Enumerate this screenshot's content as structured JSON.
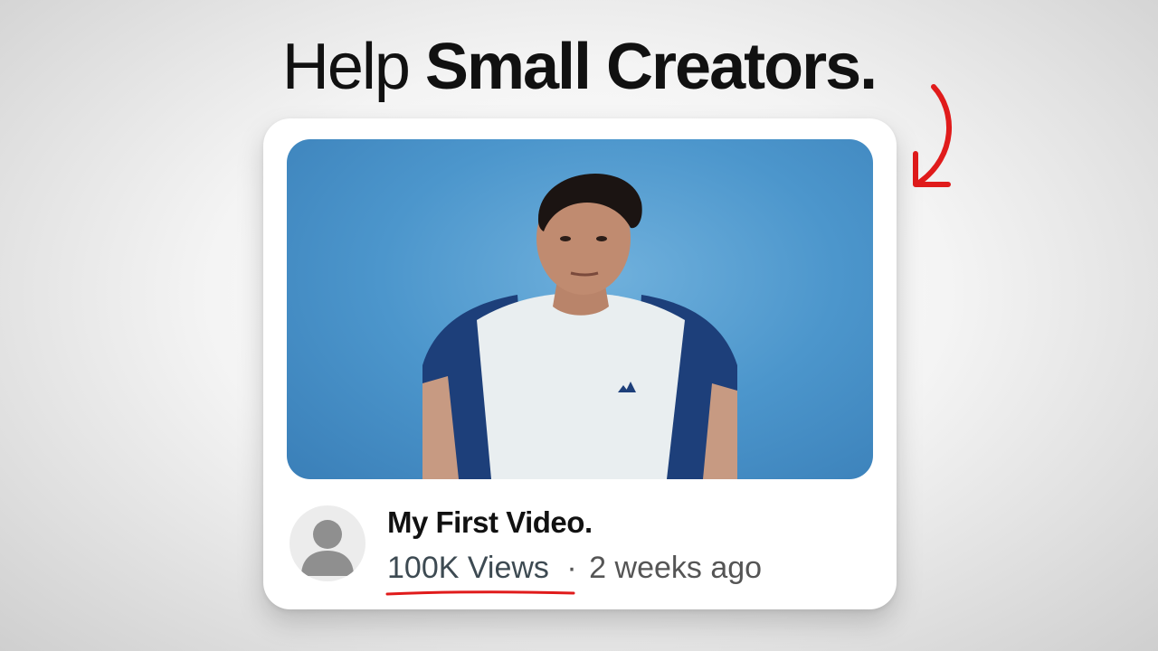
{
  "headline": {
    "light": "Help",
    "bold": "Small Creators."
  },
  "video": {
    "title": "My First Video.",
    "views": "100K Views",
    "separator": "·",
    "age": "2 weeks ago"
  },
  "icons": {
    "avatar": "user-avatar-icon",
    "arrow": "curved-arrow-icon"
  },
  "colors": {
    "accent": "#e01b1b",
    "thumb_bg": "#4c96cc",
    "text": "#111111"
  }
}
